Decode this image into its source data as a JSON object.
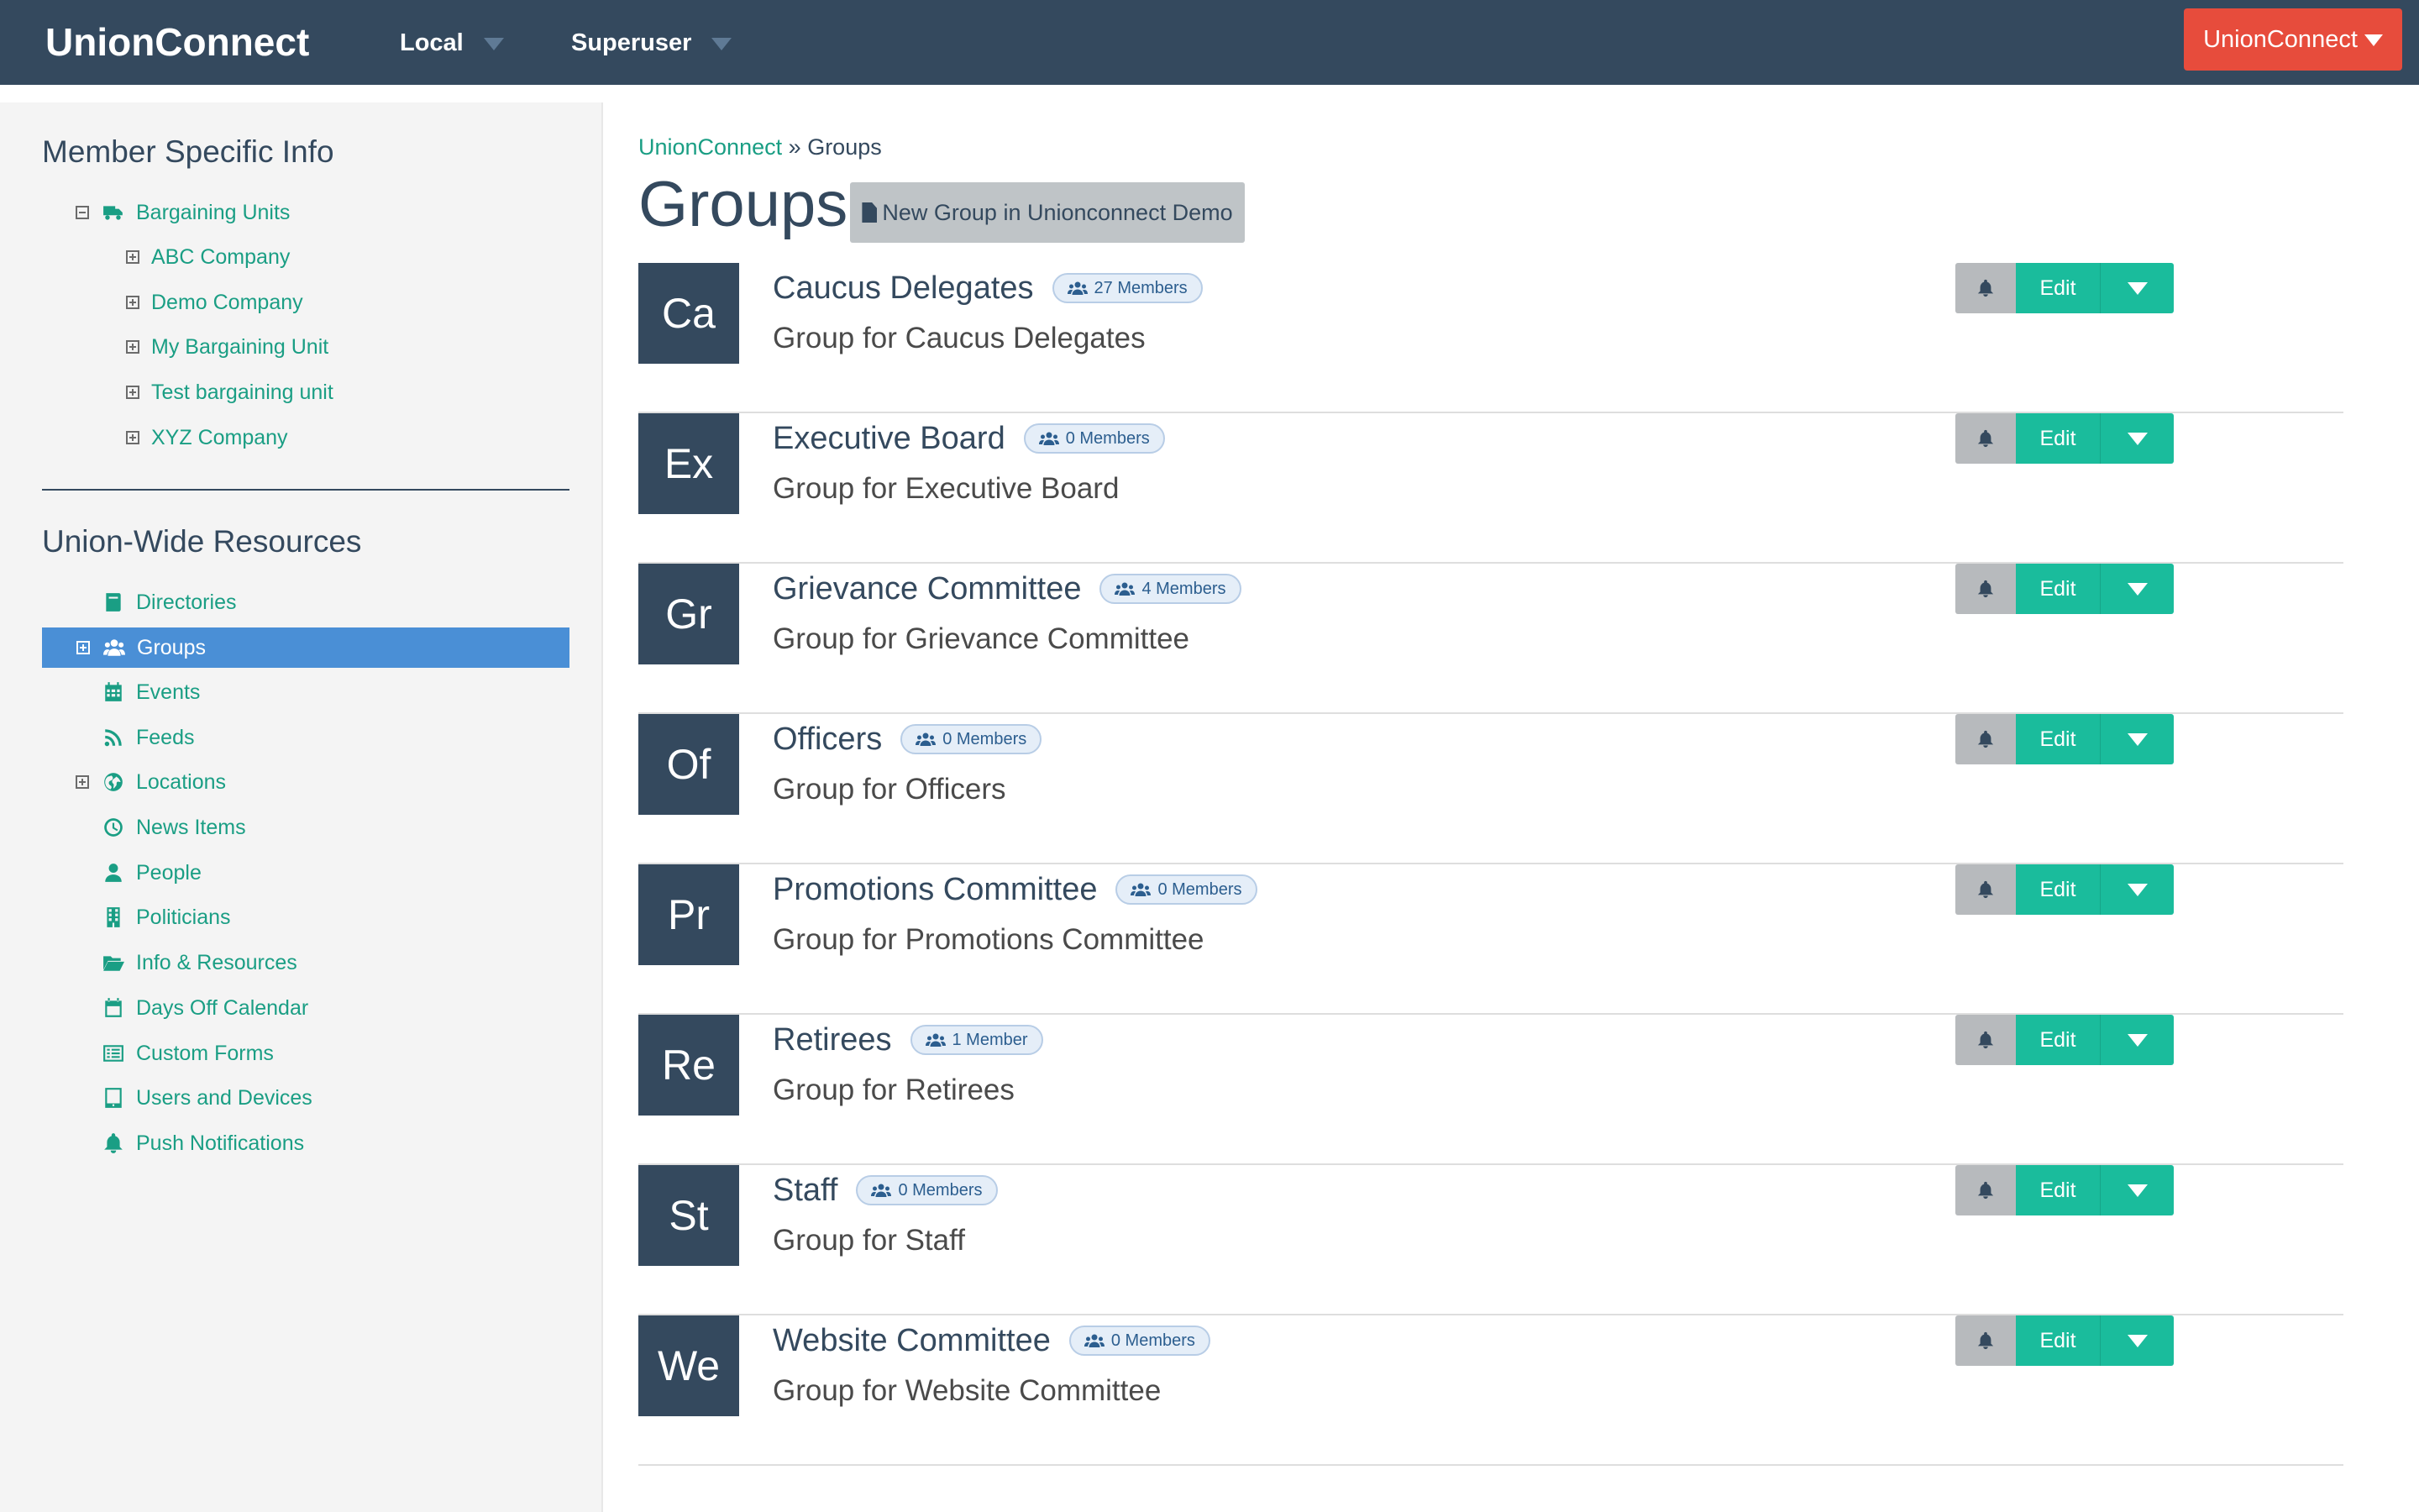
{
  "navbar": {
    "brand": "UnionConnect",
    "local_label": "Local",
    "user_label": "Superuser",
    "org_button_label": "UnionConnect"
  },
  "sidebar": {
    "member_heading": "Member Specific Info",
    "bargaining": {
      "label": "Bargaining Units",
      "icon": "truck-icon",
      "children": [
        "ABC Company",
        "Demo Company",
        "My Bargaining Unit",
        "Test bargaining unit",
        "XYZ Company"
      ]
    },
    "union_heading": "Union-Wide Resources",
    "resources": [
      {
        "label": "Directories",
        "icon": "book-icon",
        "expandable": false
      },
      {
        "label": "Groups",
        "icon": "users-icon",
        "expandable": true,
        "active": true
      },
      {
        "label": "Events",
        "icon": "calendar-grid-icon",
        "expandable": false
      },
      {
        "label": "Feeds",
        "icon": "rss-icon",
        "expandable": false
      },
      {
        "label": "Locations",
        "icon": "globe-icon",
        "expandable": true
      },
      {
        "label": "News Items",
        "icon": "clock-icon",
        "expandable": false
      },
      {
        "label": "People",
        "icon": "person-icon",
        "expandable": false
      },
      {
        "label": "Politicians",
        "icon": "building-icon",
        "expandable": false
      },
      {
        "label": "Info & Resources",
        "icon": "folder-open-icon",
        "expandable": false
      },
      {
        "label": "Days Off Calendar",
        "icon": "calendar-icon",
        "expandable": false
      },
      {
        "label": "Custom Forms",
        "icon": "list-alt-icon",
        "expandable": false
      },
      {
        "label": "Users and Devices",
        "icon": "tablet-icon",
        "expandable": false
      },
      {
        "label": "Push Notifications",
        "icon": "bell-icon",
        "expandable": false
      }
    ]
  },
  "breadcrumb": {
    "home": "UnionConnect",
    "separator": "»",
    "current": "Groups"
  },
  "page": {
    "title": "Groups",
    "new_button": "New Group in Unionconnect Demo",
    "edit_label": "Edit"
  },
  "groups": [
    {
      "initials": "Ca",
      "name": "Caucus Delegates",
      "members": "27 Members",
      "description": "Group for Caucus Delegates"
    },
    {
      "initials": "Ex",
      "name": "Executive Board",
      "members": "0 Members",
      "description": "Group for Executive Board"
    },
    {
      "initials": "Gr",
      "name": "Grievance Committee",
      "members": "4 Members",
      "description": "Group for Grievance Committee"
    },
    {
      "initials": "Of",
      "name": "Officers",
      "members": "0 Members",
      "description": "Group for Officers"
    },
    {
      "initials": "Pr",
      "name": "Promotions Committee",
      "members": "0 Members",
      "description": "Group for Promotions Committee"
    },
    {
      "initials": "Re",
      "name": "Retirees",
      "members": "1 Member",
      "description": "Group for Retirees"
    },
    {
      "initials": "St",
      "name": "Staff",
      "members": "0 Members",
      "description": "Group for Staff"
    },
    {
      "initials": "We",
      "name": "Website Committee",
      "members": "0 Members",
      "description": "Group for Website Committee"
    }
  ],
  "colors": {
    "navbar": "#34495e",
    "accent": "#1abc9c",
    "link": "#1a9e84",
    "danger": "#e74c3c",
    "active": "#4a8fd6"
  }
}
